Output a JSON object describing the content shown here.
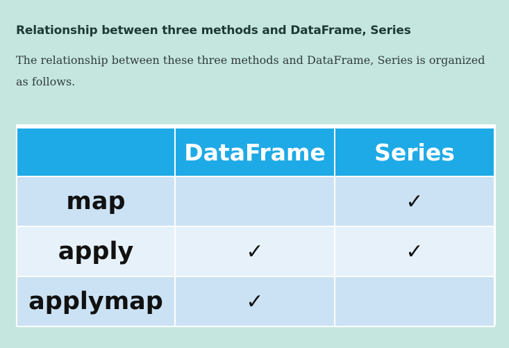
{
  "article": {
    "heading": "Relationship between three methods and DataFrame, Series",
    "paragraph": "The relationship between these three methods and DataFrame, Series is organized as follows."
  },
  "table": {
    "headers": [
      "",
      "DataFrame",
      "Series"
    ],
    "rows": [
      [
        "map",
        "",
        "✓"
      ],
      [
        "apply",
        "✓",
        "✓"
      ],
      [
        "applymap",
        "✓",
        ""
      ]
    ]
  },
  "colors": {
    "background": "#c5e6df",
    "header_bg": "#1eaae6",
    "row_dark": "#cbe2f4",
    "row_light": "#e6f1fa"
  }
}
